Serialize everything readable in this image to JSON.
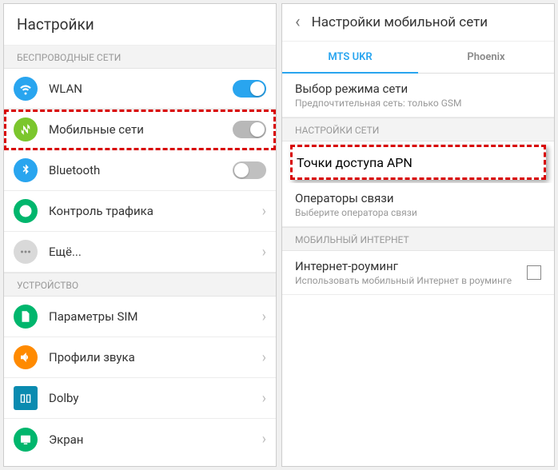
{
  "left": {
    "title": "Настройки",
    "sections": {
      "wireless": "БЕСПРОВОДНЫЕ СЕТИ",
      "device": "УСТРОЙСТВО"
    },
    "items": {
      "wlan": "WLAN",
      "mobile": "Мобильные сети",
      "bluetooth": "Bluetooth",
      "traffic": "Контроль трафика",
      "more": "Ещё...",
      "sim": "Параметры SIM",
      "sound": "Профили звука",
      "dolby": "Dolby",
      "display": "Экран"
    }
  },
  "right": {
    "title": "Настройки мобильной сети",
    "tabs": {
      "t1": "MTS UKR",
      "t2": "Phoenix"
    },
    "mode": {
      "label": "Выбор режима сети",
      "sub": "Предпочтительная сеть: только GSM"
    },
    "section_net": "НАСТРОЙКИ СЕТИ",
    "apn": "Точки доступа APN",
    "operators": {
      "label": "Операторы связи",
      "sub": "Выберите оператора связи"
    },
    "section_mi": "МОБИЛЬНЫЙ ИНТЕРНЕТ",
    "roaming": {
      "label": "Интернет-роуминг",
      "sub": "Использовать мобильный Интернет в роуминге"
    }
  }
}
